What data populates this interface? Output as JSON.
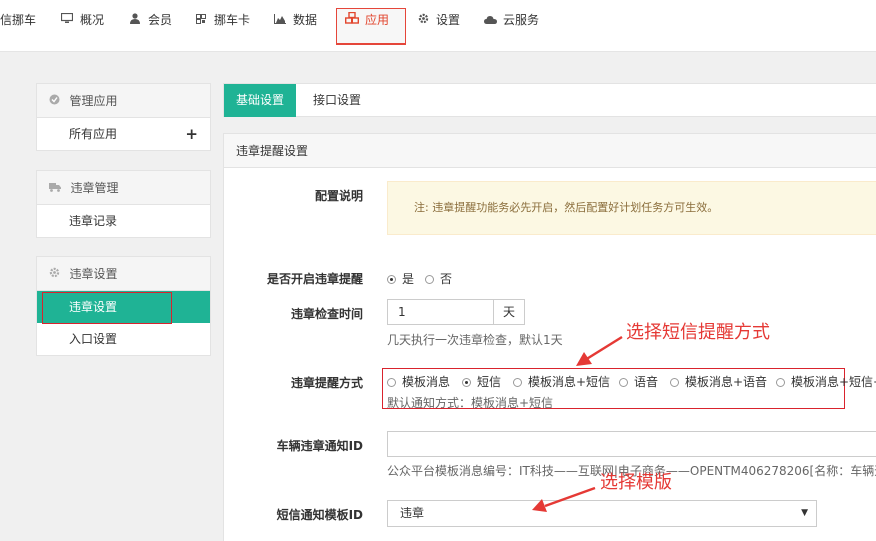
{
  "nav": {
    "items": [
      {
        "label": "信挪车",
        "icon": "none"
      },
      {
        "label": "概况",
        "icon": "monitor-icon"
      },
      {
        "label": "会员",
        "icon": "user-icon"
      },
      {
        "label": "挪车卡",
        "icon": "qrcode-icon"
      },
      {
        "label": "数据",
        "icon": "area-chart-icon"
      },
      {
        "label": "应用",
        "icon": "cubes-icon"
      },
      {
        "label": "设置",
        "icon": "gear-icon"
      },
      {
        "label": "云服务",
        "icon": "cloud-icon"
      }
    ],
    "active_index": 5,
    "accent": "#e2462e"
  },
  "sidebar": {
    "groups": [
      {
        "title": "管理应用",
        "icon": "grid-icon",
        "items": [
          {
            "label": "所有应用",
            "extra": "+"
          }
        ]
      },
      {
        "title": "违章管理",
        "icon": "truck-icon",
        "items": [
          {
            "label": "违章记录"
          }
        ]
      },
      {
        "title": "违章设置",
        "icon": "gear-icon",
        "items": [
          {
            "label": "违章设置"
          },
          {
            "label": "入口设置"
          }
        ]
      }
    ],
    "active_color": "#1fb395"
  },
  "tabs": [
    {
      "label": "基础设置"
    },
    {
      "label": "接口设置"
    }
  ],
  "content": {
    "section_title": "违章提醒设置",
    "config_note": {
      "label": "配置说明",
      "text": "注: 违章提醒功能务必先开启，然后配置好计划任务方可生效。"
    },
    "enable": {
      "label": "是否开启违章提醒",
      "options": [
        "是",
        "否"
      ],
      "selected": "是"
    },
    "interval": {
      "label": "违章检查时间",
      "value": "1",
      "unit": "天",
      "help": "几天执行一次违章检查，默认1天"
    },
    "method": {
      "label": "违章提醒方式",
      "options": [
        "模板消息",
        "短信",
        "模板消息+短信",
        "语音",
        "模板消息+语音",
        "模板消息+短信+"
      ],
      "selected": "短信",
      "help": "默认通知方式：模板消息+短信"
    },
    "vehicle_id": {
      "label": "车辆违章通知ID",
      "value": "",
      "help": "公众平台模板消息编号：IT科技——互联网|电子商务——OPENTM406278206[名称：车辆违"
    },
    "sms_template": {
      "label": "短信通知模板ID",
      "selected": "违章"
    }
  },
  "annotations": {
    "method_hint": "选择短信提醒方式",
    "template_hint": "选择模版",
    "color": "#e53935"
  }
}
